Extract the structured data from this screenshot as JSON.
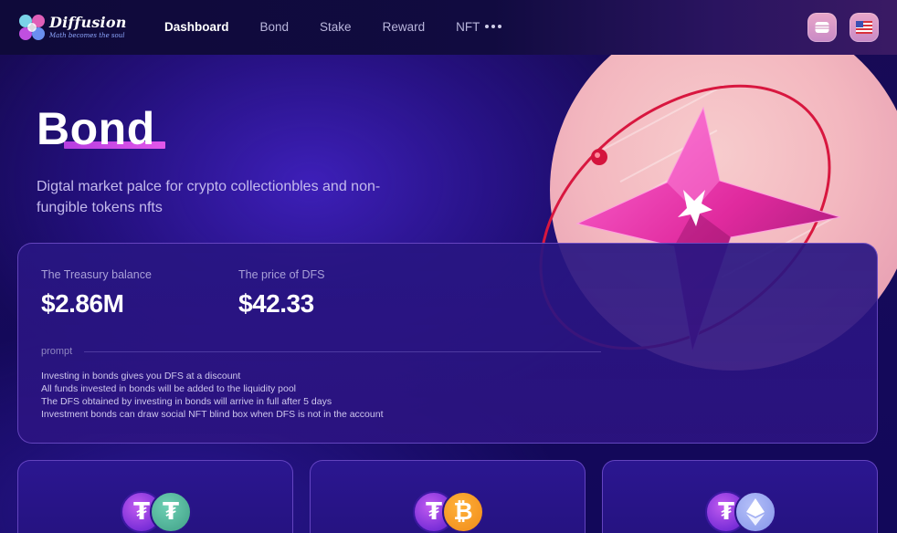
{
  "brand": {
    "name": "Diffusion",
    "tagline": "Math becomes the soul"
  },
  "nav": {
    "items": [
      {
        "label": "Dashboard",
        "active": true
      },
      {
        "label": "Bond",
        "active": false
      },
      {
        "label": "Stake",
        "active": false
      },
      {
        "label": "Reward",
        "active": false
      },
      {
        "label": "NFT",
        "active": false
      }
    ],
    "more_icon": "ellipsis-icon"
  },
  "header_actions": {
    "wallet_icon": "wallet-icon",
    "language_icon": "us-flag-icon"
  },
  "hero": {
    "title": "Bond",
    "description": "Digtal market palce for crypto collectionbles and non-fungible tokens nfts"
  },
  "stats": {
    "treasury": {
      "label": "The Treasury balance",
      "value": "$2.86M"
    },
    "price": {
      "label": "The price of DFS",
      "value": "$42.33"
    }
  },
  "prompt": {
    "label": "prompt",
    "lines": [
      "Investing in bonds gives you DFS at a discount",
      "All funds invested in bonds will be added to the liquidity pool",
      "The DFS obtained by investing in bonds will arrive in full after 5 days",
      "Investment bonds can draw social NFT blind box when DFS is not in the account"
    ]
  },
  "bonds": [
    {
      "base_icon": "dfs-token-icon",
      "quote_icon": "usdt-token-icon"
    },
    {
      "base_icon": "dfs-token-icon",
      "quote_icon": "btc-token-icon"
    },
    {
      "base_icon": "dfs-token-icon",
      "quote_icon": "eth-token-icon"
    }
  ],
  "colors": {
    "accent_underline": "#c94ae6",
    "card_border": "#8c64e6",
    "background": "#180a55",
    "usdt": "#50af95",
    "btc": "#f7931a",
    "eth": "#8c9eef"
  }
}
